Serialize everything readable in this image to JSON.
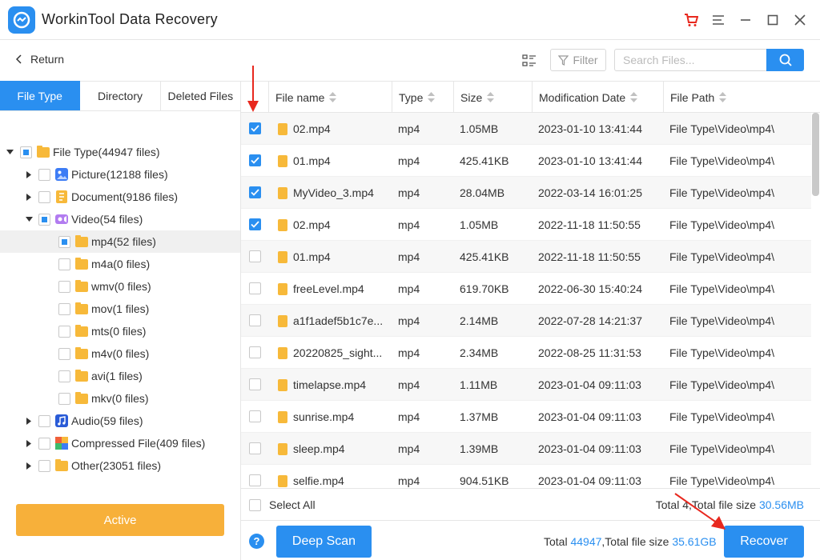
{
  "app": {
    "title": "WorkinTool Data Recovery"
  },
  "window_controls": [
    "cart-icon",
    "menu-icon",
    "minimize-icon",
    "maximize-icon",
    "close-icon"
  ],
  "toolbar": {
    "return_label": "Return",
    "filter_label": "Filter",
    "search_placeholder": "Search Files..."
  },
  "tabs": [
    {
      "label": "File Type",
      "active": true
    },
    {
      "label": "Directory",
      "active": false
    },
    {
      "label": "Deleted Files",
      "active": false
    }
  ],
  "tree": {
    "root": {
      "label": "File Type(44947 files)",
      "state": "partial",
      "expanded": true
    },
    "picture": {
      "label": "Picture(12188 files)",
      "state": "unchecked",
      "expanded": false
    },
    "document": {
      "label": "Document(9186 files)",
      "state": "unchecked",
      "expanded": false
    },
    "video": {
      "label": "Video(54 files)",
      "state": "partial",
      "expanded": true
    },
    "video_children": [
      {
        "label": "mp4(52 files)",
        "state": "partial",
        "selected": true
      },
      {
        "label": "m4a(0 files)",
        "state": "unchecked"
      },
      {
        "label": "wmv(0 files)",
        "state": "unchecked"
      },
      {
        "label": "mov(1 files)",
        "state": "unchecked"
      },
      {
        "label": "mts(0 files)",
        "state": "unchecked"
      },
      {
        "label": "m4v(0 files)",
        "state": "unchecked"
      },
      {
        "label": "avi(1 files)",
        "state": "unchecked"
      },
      {
        "label": "mkv(0 files)",
        "state": "unchecked"
      }
    ],
    "audio": {
      "label": "Audio(59 files)",
      "state": "unchecked",
      "expanded": false
    },
    "compressed": {
      "label": "Compressed File(409 files)",
      "state": "unchecked",
      "expanded": false
    },
    "other": {
      "label": "Other(23051 files)",
      "state": "unchecked",
      "expanded": false
    }
  },
  "active_button": "Active",
  "table": {
    "headers": [
      "File name",
      "Type",
      "Size",
      "Modification Date",
      "File Path"
    ],
    "rows": [
      {
        "checked": true,
        "name": "02.mp4",
        "type": "mp4",
        "size": "1.05MB",
        "date": "2023-01-10 13:41:44",
        "path": "File Type\\Video\\mp4\\"
      },
      {
        "checked": true,
        "name": "01.mp4",
        "type": "mp4",
        "size": "425.41KB",
        "date": "2023-01-10 13:41:44",
        "path": "File Type\\Video\\mp4\\"
      },
      {
        "checked": true,
        "name": "MyVideo_3.mp4",
        "type": "mp4",
        "size": "28.04MB",
        "date": "2022-03-14 16:01:25",
        "path": "File Type\\Video\\mp4\\"
      },
      {
        "checked": true,
        "name": "02.mp4",
        "type": "mp4",
        "size": "1.05MB",
        "date": "2022-11-18 11:50:55",
        "path": "File Type\\Video\\mp4\\"
      },
      {
        "checked": false,
        "name": "01.mp4",
        "type": "mp4",
        "size": "425.41KB",
        "date": "2022-11-18 11:50:55",
        "path": "File Type\\Video\\mp4\\"
      },
      {
        "checked": false,
        "name": "freeLevel.mp4",
        "type": "mp4",
        "size": "619.70KB",
        "date": "2022-06-30 15:40:24",
        "path": "File Type\\Video\\mp4\\"
      },
      {
        "checked": false,
        "name": "a1f1adef5b1c7e...",
        "type": "mp4",
        "size": "2.14MB",
        "date": "2022-07-28 14:21:37",
        "path": "File Type\\Video\\mp4\\"
      },
      {
        "checked": false,
        "name": "20220825_sight...",
        "type": "mp4",
        "size": "2.34MB",
        "date": "2022-08-25 11:31:53",
        "path": "File Type\\Video\\mp4\\"
      },
      {
        "checked": false,
        "name": "timelapse.mp4",
        "type": "mp4",
        "size": "1.11MB",
        "date": "2023-01-04 09:11:03",
        "path": "File Type\\Video\\mp4\\"
      },
      {
        "checked": false,
        "name": "sunrise.mp4",
        "type": "mp4",
        "size": "1.37MB",
        "date": "2023-01-04 09:11:03",
        "path": "File Type\\Video\\mp4\\"
      },
      {
        "checked": false,
        "name": "sleep.mp4",
        "type": "mp4",
        "size": "1.39MB",
        "date": "2023-01-04 09:11:03",
        "path": "File Type\\Video\\mp4\\"
      },
      {
        "checked": false,
        "name": "selfie.mp4",
        "type": "mp4",
        "size": "904.51KB",
        "date": "2023-01-04 09:11:03",
        "path": "File Type\\Video\\mp4\\"
      }
    ]
  },
  "selection": {
    "select_all_label": "Select All",
    "prefix": "Total ",
    "count": "4",
    "mid": ",Total file size ",
    "size": "30.56MB"
  },
  "bottom": {
    "help_label": "?",
    "deep_scan_label": "Deep Scan",
    "total_prefix": "Total ",
    "total_count": "44947",
    "total_mid": ",Total file size ",
    "total_size": "35.61GB",
    "recover_label": "Recover"
  },
  "colors": {
    "accent": "#2a8ff0",
    "active_button": "#f7b03a",
    "folder": "#f7b93a",
    "annotation_arrow": "#e8281e"
  }
}
